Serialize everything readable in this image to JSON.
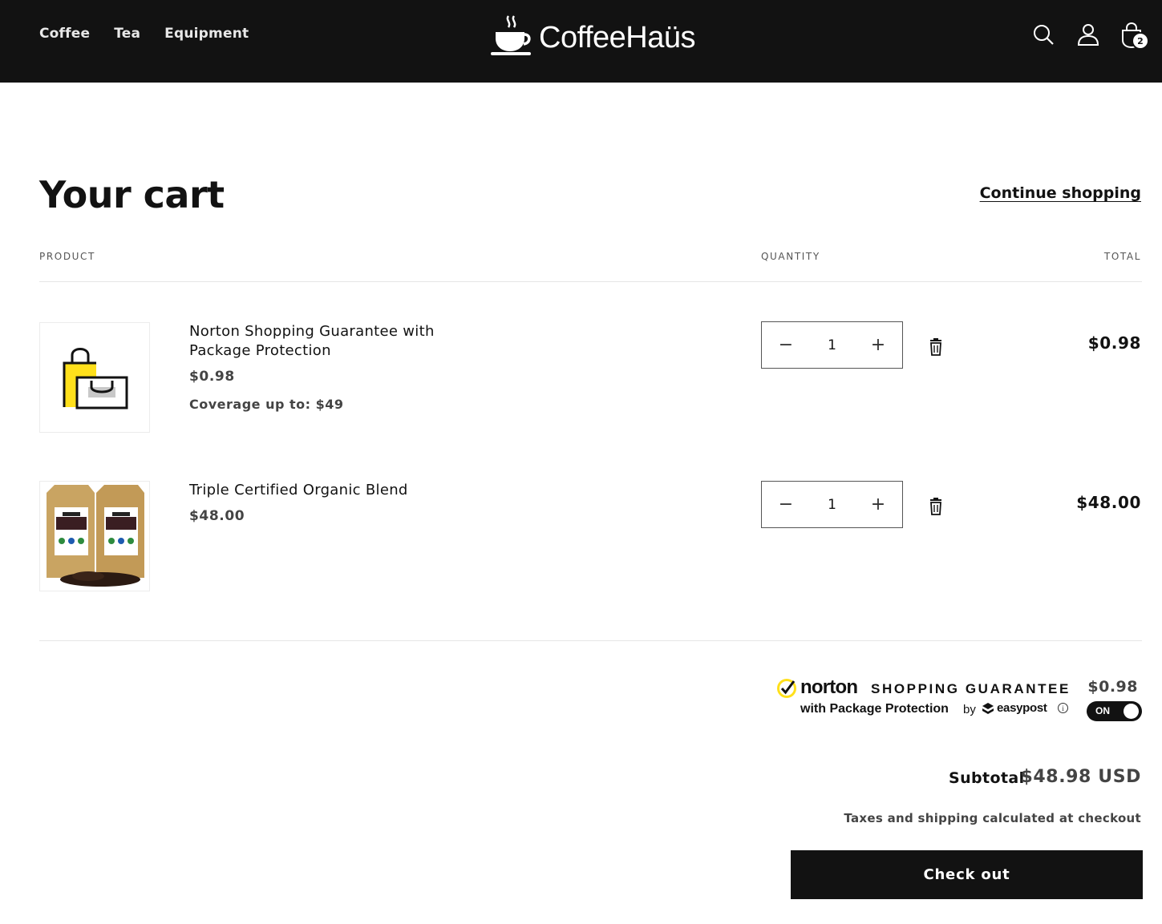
{
  "header": {
    "nav": [
      "Coffee",
      "Tea",
      "Equipment"
    ],
    "logo_text": "CoffeeHaüs",
    "cart_count": "2"
  },
  "page": {
    "title": "Your cart",
    "continue_label": "Continue shopping"
  },
  "table": {
    "col_product": "PRODUCT",
    "col_quantity": "QUANTITY",
    "col_total": "TOTAL"
  },
  "items": [
    {
      "name": "Norton Shopping Guarantee with Package Protection",
      "price": "$0.98",
      "meta": "Coverage up to: $49",
      "quantity": "1",
      "total": "$0.98"
    },
    {
      "name": "Triple Certified Organic Blend",
      "price": "$48.00",
      "quantity": "1",
      "total": "$48.00"
    }
  ],
  "norton": {
    "brand": "norton",
    "tagline": "SHOPPING GUARANTEE",
    "subline": "with Package Protection",
    "by": "by",
    "partner": "easypost",
    "price": "$0.98",
    "toggle_label": "ON"
  },
  "summary": {
    "subtotal_label": "Subtotal",
    "subtotal_value": "$48.98 USD",
    "tax_note": "Taxes and shipping calculated at checkout",
    "checkout_label": "Check out"
  },
  "colors": {
    "header_bg": "#121212",
    "norton_yellow": "#ffe01b",
    "button_bg": "#121212"
  }
}
